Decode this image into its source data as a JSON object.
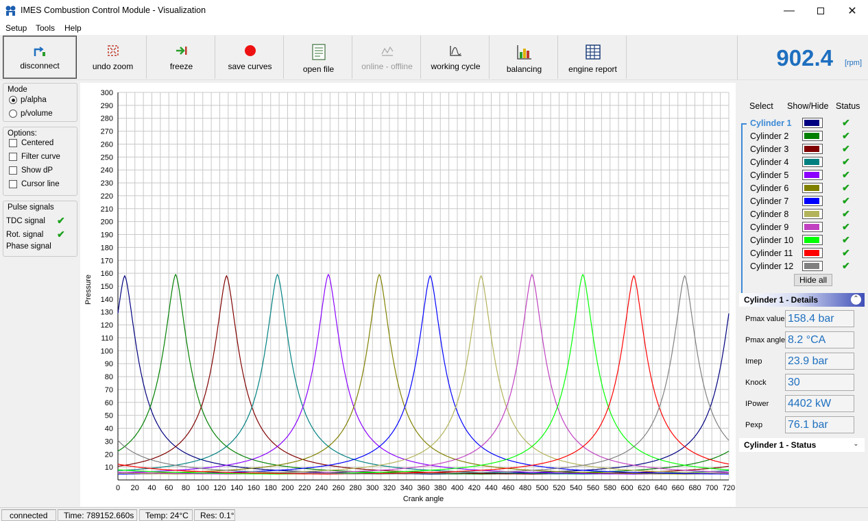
{
  "window": {
    "title": "IMES Combustion Control Module - Visualization"
  },
  "menu": {
    "setup": "Setup",
    "tools": "Tools",
    "help": "Help"
  },
  "toolbar": {
    "disconnect": "disconnect",
    "undo_zoom": "undo zoom",
    "freeze": "freeze",
    "save_curves": "save curves",
    "open_file": "open file",
    "online_offline": "online - offline",
    "working_cycle": "working cycle",
    "balancing": "balancing",
    "engine_report": "engine report"
  },
  "rpm": {
    "value": "902.4",
    "unit": "[rpm]"
  },
  "mode": {
    "title": "Mode",
    "p_alpha": "p/alpha",
    "p_volume": "p/volume",
    "selected": "p/alpha"
  },
  "options": {
    "title": "Options:",
    "centered": "Centered",
    "filter_curve": "Filter curve",
    "show_dp": "Show dP",
    "cursor_line": "Cursor line"
  },
  "pulse": {
    "title": "Pulse signals",
    "tdc": "TDC signal",
    "rot": "Rot. signal",
    "phase": "Phase signal",
    "tdc_ok": true,
    "rot_ok": true
  },
  "cylinders_panel": {
    "col_select": "Select",
    "col_show_hide": "Show/Hide",
    "col_status": "Status",
    "hide_all": "Hide all",
    "items": [
      {
        "name": "Cylinder 1",
        "color": "#000080",
        "status": true
      },
      {
        "name": "Cylinder 2",
        "color": "#008000",
        "status": true
      },
      {
        "name": "Cylinder 3",
        "color": "#800000",
        "status": true
      },
      {
        "name": "Cylinder 4",
        "color": "#008080",
        "status": true
      },
      {
        "name": "Cylinder 5",
        "color": "#8b00ff",
        "status": true
      },
      {
        "name": "Cylinder 6",
        "color": "#808000",
        "status": true
      },
      {
        "name": "Cylinder 7",
        "color": "#0000ff",
        "status": true
      },
      {
        "name": "Cylinder 8",
        "color": "#b3b35a",
        "status": true
      },
      {
        "name": "Cylinder 9",
        "color": "#c040c0",
        "status": true
      },
      {
        "name": "Cylinder 10",
        "color": "#00ff00",
        "status": true
      },
      {
        "name": "Cylinder 11",
        "color": "#ff0000",
        "status": true
      },
      {
        "name": "Cylinder 12",
        "color": "#808080",
        "status": true
      }
    ]
  },
  "details": {
    "title": "Cylinder 1 - Details",
    "pmax_value_label": "Pmax value",
    "pmax_value": "158.4 bar",
    "pmax_angle_label": "Pmax angle",
    "pmax_angle": "8.2 °CA",
    "imep_label": "Imep",
    "imep": "23.9 bar",
    "knock_label": "Knock",
    "knock": "30",
    "ipower_label": "IPower",
    "ipower": "4402 kW",
    "pexp_label": "Pexp",
    "pexp": "76.1 bar"
  },
  "status_section": {
    "title": "Cylinder 1 - Status"
  },
  "statusbar": {
    "connection": "connected",
    "time": "Time: 789152.660s",
    "temp": "Temp: 24°C",
    "res": "Res: 0.1°"
  },
  "chart_data": {
    "type": "line",
    "xlabel": "Crank angle",
    "ylabel": "Pressure",
    "xlim": [
      0,
      720
    ],
    "ylim": [
      0,
      300
    ],
    "x_ticks": [
      0,
      20,
      40,
      60,
      80,
      100,
      120,
      140,
      160,
      180,
      200,
      220,
      240,
      260,
      280,
      300,
      320,
      340,
      360,
      380,
      400,
      420,
      440,
      460,
      480,
      500,
      520,
      540,
      560,
      580,
      600,
      620,
      640,
      660,
      680,
      700,
      720
    ],
    "y_ticks": [
      10,
      20,
      30,
      40,
      50,
      60,
      70,
      80,
      90,
      100,
      110,
      120,
      130,
      140,
      150,
      160,
      170,
      180,
      190,
      200,
      210,
      220,
      230,
      240,
      250,
      260,
      270,
      280,
      290,
      300
    ],
    "grid": true,
    "series": [
      {
        "name": "Cylinder 1",
        "color": "#000080",
        "peak_angle": 8,
        "peak_pressure": 158
      },
      {
        "name": "Cylinder 2",
        "color": "#008000",
        "peak_angle": 68,
        "peak_pressure": 159
      },
      {
        "name": "Cylinder 3",
        "color": "#800000",
        "peak_angle": 128,
        "peak_pressure": 158
      },
      {
        "name": "Cylinder 4",
        "color": "#008080",
        "peak_angle": 188,
        "peak_pressure": 159
      },
      {
        "name": "Cylinder 5",
        "color": "#8b00ff",
        "peak_angle": 248,
        "peak_pressure": 159
      },
      {
        "name": "Cylinder 6",
        "color": "#808000",
        "peak_angle": 308,
        "peak_pressure": 159
      },
      {
        "name": "Cylinder 7",
        "color": "#0000ff",
        "peak_angle": 368,
        "peak_pressure": 158
      },
      {
        "name": "Cylinder 8",
        "color": "#b3b35a",
        "peak_angle": 428,
        "peak_pressure": 158
      },
      {
        "name": "Cylinder 9",
        "color": "#c040c0",
        "peak_angle": 488,
        "peak_pressure": 159
      },
      {
        "name": "Cylinder 10",
        "color": "#00ff00",
        "peak_angle": 548,
        "peak_pressure": 159
      },
      {
        "name": "Cylinder 11",
        "color": "#ff0000",
        "peak_angle": 608,
        "peak_pressure": 158
      },
      {
        "name": "Cylinder 12",
        "color": "#808080",
        "peak_angle": 668,
        "peak_pressure": 158
      }
    ]
  }
}
